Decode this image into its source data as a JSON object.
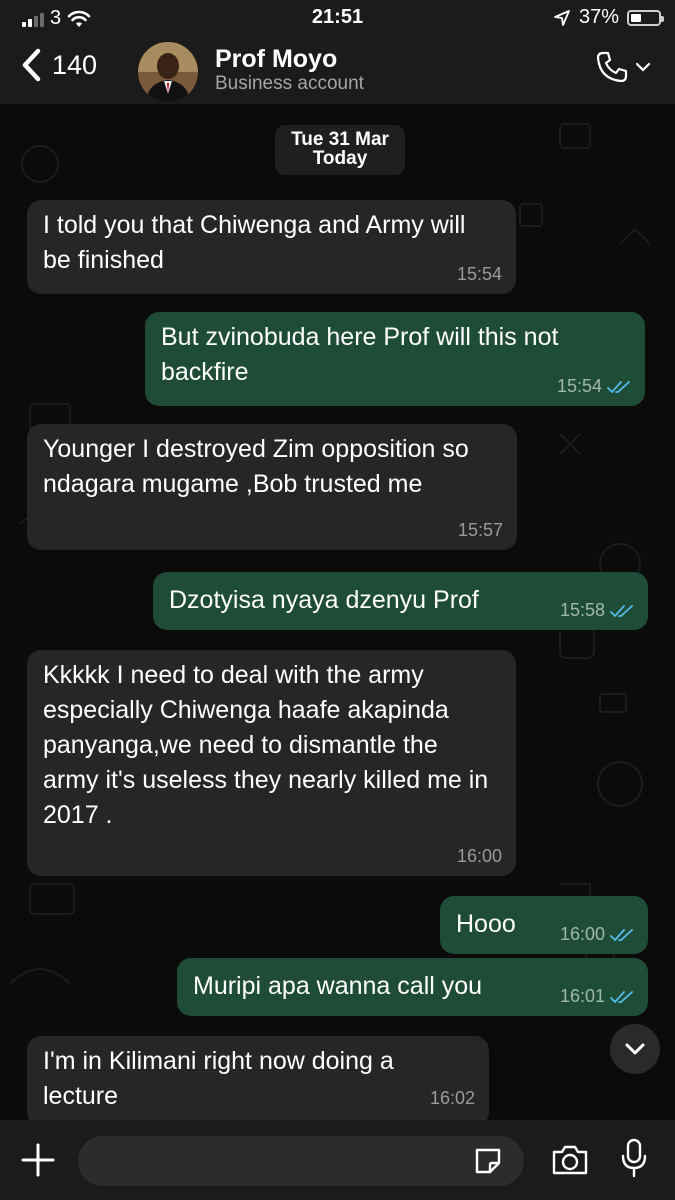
{
  "status_bar": {
    "carrier": "3",
    "time": "21:51",
    "battery": "37%",
    "battery_level": 0.37
  },
  "header": {
    "back_count": "140",
    "contact_name": "Prof Moyo",
    "contact_subtitle": "Business account"
  },
  "date_divider": {
    "date": "Tue 31 Mar",
    "overlay": "Today"
  },
  "messages": [
    {
      "dir": "in",
      "text": "I told you  that Chiwenga and Army will be finished",
      "time": "15:54"
    },
    {
      "dir": "out",
      "text": "But zvinobuda here Prof will this not backfire",
      "time": "15:54",
      "status": "read"
    },
    {
      "dir": "in",
      "text": "Younger I destroyed  Zim opposition so ndagara  mugame  ,Bob trusted me",
      "time": "15:57"
    },
    {
      "dir": "out",
      "text": "Dzotyisa nyaya dzenyu Prof",
      "time": "15:58",
      "status": "read"
    },
    {
      "dir": "in",
      "text": "Kkkkk I need  to deal with the army especially  Chiwenga  haafe akapinda  panyanga,we need to dismantle  the army it's useless they nearly  killed  me  in 2017 .",
      "time": "16:00"
    },
    {
      "dir": "out",
      "text": "Hooo",
      "time": "16:00",
      "status": "read"
    },
    {
      "dir": "out",
      "text": "Muripi apa wanna call you",
      "time": "16:01",
      "status": "read"
    },
    {
      "dir": "in",
      "text": "I'm in Kilimani right  now doing  a lecture",
      "time": "16:02"
    }
  ],
  "icons": {
    "back": "chevron-left-icon",
    "call": "phone-icon",
    "call_menu": "chevron-down-icon",
    "scroll": "chevron-down-icon",
    "attach": "plus-icon",
    "sticker": "sticker-icon",
    "camera": "camera-icon",
    "mic": "microphone-icon",
    "read": "double-check-icon"
  },
  "colors": {
    "incoming_bubble": "#262626",
    "outgoing_bubble": "#1f4c37",
    "read_ticks": "#53bdeb",
    "background": "#0b0b0b"
  },
  "input": {
    "value": "",
    "placeholder": ""
  }
}
